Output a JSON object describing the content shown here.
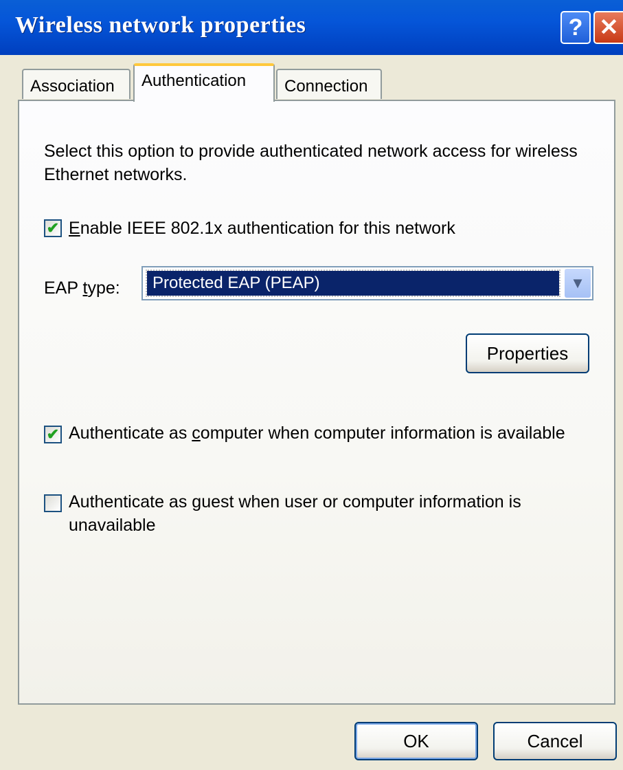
{
  "window": {
    "title": "Wireless network properties",
    "help_glyph": "?",
    "close_glyph": "✕"
  },
  "tabs": [
    {
      "label": "Association",
      "active": false
    },
    {
      "label": "Authentication",
      "active": true
    },
    {
      "label": "Connection",
      "active": false
    }
  ],
  "panel": {
    "description": "Select this option to provide authenticated network access for wireless Ethernet networks.",
    "enable_8021x": {
      "label_prefix": "",
      "label_mnemonic": "E",
      "label_rest": "nable IEEE 802.1x authentication for this network",
      "checked": true
    },
    "eap_type": {
      "label_prefix": "EAP ",
      "label_mnemonic": "t",
      "label_rest": "ype:",
      "selected": "Protected EAP (PEAP)"
    },
    "properties_button": "Properties",
    "auth_as_computer": {
      "label_prefix": "Authenticate as ",
      "label_mnemonic": "c",
      "label_rest": "omputer when computer information is available",
      "checked": true
    },
    "auth_as_guest": {
      "label_prefix": "Authenticate as ",
      "label_mnemonic": "g",
      "label_rest": "uest when user or computer information is unavailable",
      "checked": false
    }
  },
  "footer": {
    "ok": "OK",
    "cancel": "Cancel"
  },
  "colors": {
    "titlebar": "#0555d8",
    "dialog_bg": "#ece9d8",
    "active_tab_accent": "#ffc83c",
    "selection": "#0a246a",
    "check_mark": "#21a121"
  }
}
